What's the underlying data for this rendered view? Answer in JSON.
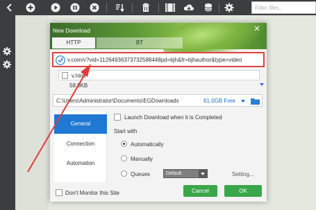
{
  "toolbar": {
    "filter_placeholder": "Filter files...",
    "icons": [
      "add-icon",
      "play-icon",
      "pause-icon",
      "stop-icon",
      "sort-icon",
      "delete-icon",
      "video-icon",
      "cloud-download-icon",
      "database-icon",
      "gear-icon"
    ]
  },
  "dialog": {
    "title": "New Download",
    "tabs": [
      "HTTP",
      "BT"
    ],
    "url": "v.com/v?vid=11264936373732588448pd=bjh&fr=bjhauthor&type=video",
    "file_name": "v.html",
    "file_size": "58.0KB",
    "save_path": "C:\\Users\\Administrator\\Documents\\EGDownloads",
    "free_space": "61.0GB Free",
    "nav": [
      "General",
      "Connection",
      "Automation"
    ],
    "launch_label": "Launch Download when it is Completed",
    "start_with_label": "Start with",
    "options": [
      "Automatically",
      "Manually",
      "Queues"
    ],
    "queue_value": "Default",
    "settings_label": "Setting...",
    "dont_monitor_label": "Don't Monitor this Site",
    "cancel_label": "Cancel",
    "ok_label": "OK"
  },
  "colors": {
    "accent_blue": "#1f78d2",
    "button_green": "#3aa64a",
    "highlight_red": "#e04040"
  }
}
